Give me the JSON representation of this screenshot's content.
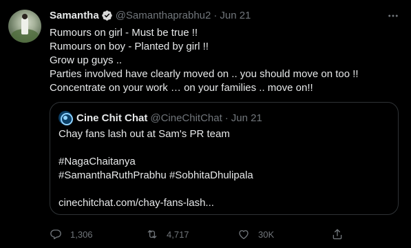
{
  "tweet": {
    "author_name": "Samantha",
    "author_handle": "@Samanthaprabhu2",
    "separator": "·",
    "date": "Jun 21",
    "lines": [
      "Rumours on girl - Must be true !!",
      "Rumours on boy - Planted by girl !!",
      "Grow up guys ..",
      "Parties involved have clearly moved on .. you should move on too !!",
      "Concentrate on your work … on your families .. move on!!"
    ]
  },
  "quote": {
    "author_name": "Cine Chit Chat",
    "author_handle": "@CineChitChat",
    "separator": "·",
    "date": "Jun 21",
    "headline": "Chay fans lash out at Sam's PR team",
    "hashtag_line1": "#NagaChaitanya",
    "hashtag_line2": "#SamanthaRuthPrabhu #SobhitaDhulipala",
    "link": "cinechitchat.com/chay-fans-lash..."
  },
  "actions": {
    "replies": "1,306",
    "retweets": "4,717",
    "likes": "30K"
  },
  "colors": {
    "background": "#000000",
    "text": "#e7e9ea",
    "secondary": "#71767b",
    "border": "#2f3336",
    "verified": "#1d9bf0"
  },
  "icons": [
    "verified-badge-icon",
    "more-options-icon",
    "reply-icon",
    "retweet-icon",
    "like-icon",
    "share-icon"
  ]
}
